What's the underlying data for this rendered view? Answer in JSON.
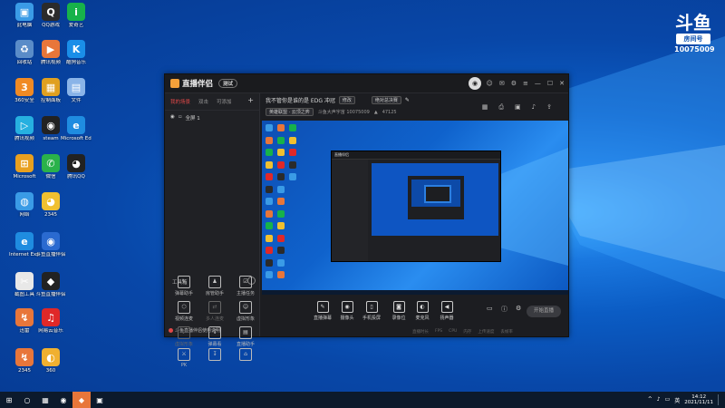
{
  "desktop": {
    "icons": [
      {
        "label": "此电脑",
        "color": "#3a9be6",
        "glyph": "▣"
      },
      {
        "label": "QQ游戏",
        "color": "#2b2b2b",
        "glyph": "Q"
      },
      {
        "label": "爱奇艺",
        "color": "#17b24a",
        "glyph": "i"
      },
      {
        "label": "回收站",
        "color": "#5a8cc8",
        "glyph": "♻"
      },
      {
        "label": "腾讯视频",
        "color": "#e8763a",
        "glyph": "▶"
      },
      {
        "label": "酷狗音乐",
        "color": "#1a8ee8",
        "glyph": "K"
      },
      {
        "label": "360安全",
        "color": "#f08a24",
        "glyph": "3"
      },
      {
        "label": "控制面板",
        "color": "#e0a020",
        "glyph": "▦"
      },
      {
        "label": "文件",
        "color": "#8ab4e8",
        "glyph": "▤"
      },
      {
        "label": "腾讯视频",
        "color": "#26b0e0",
        "glyph": "▷"
      },
      {
        "label": "steam",
        "color": "#222",
        "glyph": "◉"
      },
      {
        "label": "Microsoft Edge",
        "color": "#1f8ce0",
        "glyph": "e"
      },
      {
        "label": "Microsoft",
        "color": "#e8a020",
        "glyph": "⊞"
      },
      {
        "label": "微信",
        "color": "#2ab24a",
        "glyph": "✆"
      },
      {
        "label": "腾讯QQ",
        "color": "#222",
        "glyph": "◕"
      },
      {
        "label": "网络",
        "color": "#3a9be6",
        "glyph": "◍"
      },
      {
        "label": "2345",
        "color": "#f0c030",
        "glyph": "◕"
      },
      {
        "label": "Internet Explorer",
        "color": "#1f8ce0",
        "glyph": "e"
      },
      {
        "label": "斗鱼直播伴侣",
        "color": "#2a6ad0",
        "glyph": "◉"
      },
      {
        "label": "截图工具",
        "color": "#e8e8e8",
        "glyph": "✂"
      },
      {
        "label": "斗鱼直播伴侣",
        "color": "#222",
        "glyph": "◆"
      },
      {
        "label": "迅雷",
        "color": "#e8763a",
        "glyph": "↯"
      },
      {
        "label": "网易云音乐",
        "color": "#e02828",
        "glyph": "♫"
      },
      {
        "label": "2345",
        "color": "#e8763a",
        "glyph": "↯"
      },
      {
        "label": "360",
        "color": "#f0b030",
        "glyph": "◐"
      }
    ]
  },
  "badge": {
    "logo": "斗鱼",
    "room_label": "房间号",
    "room_number": "10075009"
  },
  "app": {
    "title": "直播伴侣",
    "version": "测试",
    "avatar": "◉",
    "titlebar_icons": [
      "☺",
      "✉",
      "⚙",
      "≡",
      "—",
      "☐",
      "✕"
    ],
    "tabs": [
      "我的场景",
      "双击",
      "可添加"
    ],
    "add_tab": "+",
    "scene_item": "全屏 1",
    "tools_header": "工具箱",
    "tools": [
      {
        "label": "弹幕助手",
        "glyph": "✎",
        "dim": false
      },
      {
        "label": "房管助手",
        "glyph": "♟",
        "dim": false
      },
      {
        "label": "主播任务",
        "glyph": "☑",
        "dim": false
      },
      {
        "label": "视频连麦",
        "glyph": "⬡",
        "dim": false
      },
      {
        "label": "多人连麦",
        "glyph": "⇄",
        "dim": true
      },
      {
        "label": "虚拟形象",
        "glyph": "☺",
        "dim": false
      },
      {
        "label": "虚拟形象",
        "glyph": "♪",
        "dim": true
      },
      {
        "label": "弹幕看",
        "glyph": "↧",
        "dim": false
      },
      {
        "label": "直播助手",
        "glyph": "▤",
        "dim": false
      },
      {
        "label": "PK",
        "glyph": "⚔",
        "dim": false
      },
      {
        "label": "",
        "glyph": "↧",
        "dim": false
      },
      {
        "label": "",
        "glyph": "⌂",
        "dim": false
      }
    ],
    "notice": "斗鱼直播伴侣使用说明",
    "room": {
      "title": "我不管你是谁的是 EDG 冲冠",
      "edit_chip": "修改",
      "category_chip": "绝对总决赛",
      "meta_chip1": "英雄联盟 · 云顶之弈",
      "meta_text": "斗鱼大声宇宙 10075009",
      "viewers": "47125"
    },
    "right_icons": [
      "▦",
      "⎙",
      "▣",
      "♪",
      "⇪"
    ],
    "preview_window_title": "直播伴侣",
    "controls": [
      {
        "label": "直播弹幕",
        "glyph": "✎"
      },
      {
        "label": "摄像头",
        "glyph": "◉"
      },
      {
        "label": "手机投屏",
        "glyph": "▯"
      },
      {
        "label": "录像位",
        "glyph": "◙"
      },
      {
        "label": "麦克风",
        "glyph": "◐"
      },
      {
        "label": "扬声器",
        "glyph": "◀"
      }
    ],
    "start_button": "开始直播",
    "status": [
      "直播时长",
      "FPS",
      "CPU",
      "内存",
      "上传速度",
      "丢帧率"
    ]
  },
  "taskbar": {
    "icons": [
      "⊞",
      "○",
      "▦",
      "◉",
      "◆",
      "▣"
    ],
    "tray": [
      "^",
      "♪",
      "▭",
      "英"
    ],
    "time": "14:12",
    "date": "2021/11/11"
  }
}
